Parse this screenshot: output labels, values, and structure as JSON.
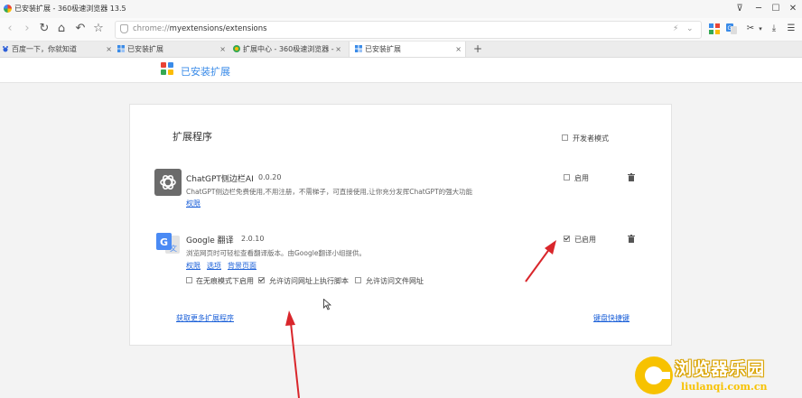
{
  "window": {
    "title": "已安装扩展 - 360极速浏览器 13.5",
    "controls": {
      "pin": "⊽",
      "minimize": "─",
      "maximize": "☐",
      "close": "✕"
    }
  },
  "address_bar": {
    "scheme": "chrome://",
    "host_path": "myextensions/extensions",
    "right_icons": [
      "⚡",
      "⌄",
      "☆"
    ]
  },
  "tabs": [
    {
      "label": "百度一下，你就知道",
      "active": false
    },
    {
      "label": "已安装扩展",
      "active": false
    },
    {
      "label": "扩展中心 - 360极速浏览器 -",
      "active": false
    },
    {
      "label": "已安装扩展",
      "active": true
    }
  ],
  "new_tab_label": "+",
  "header": {
    "title": "已安装扩展"
  },
  "section": {
    "title": "扩展程序",
    "developer_mode_label": "开发者模式",
    "developer_mode_checked": false
  },
  "extensions": [
    {
      "name": "ChatGPT侧边栏AI",
      "version": "0.0.20",
      "description": "ChatGPT侧边栏免费使用,不用注册，不需梯子，可直接使用,让你充分发挥ChatGPT的强大功能",
      "links": [
        "权限"
      ],
      "enable_label": "启用",
      "enabled": false
    },
    {
      "name": "Google 翻译",
      "version": "2.0.10",
      "description": "浏览网页时可轻松查看翻译版本。由Google翻译小组提供。",
      "links": [
        "权限",
        "选项",
        "背景页面"
      ],
      "enable_label": "已启用",
      "enabled": true,
      "options": [
        {
          "label": "在无痕模式下启用",
          "checked": false
        },
        {
          "label": "允许访问网址上执行脚本",
          "checked": true
        },
        {
          "label": "允许访问文件网址",
          "checked": false
        }
      ]
    }
  ],
  "footer": {
    "get_more": "获取更多扩展程序",
    "shortcuts": "键盘快捷键"
  },
  "watermark": {
    "title": "浏览器乐园",
    "url": "liulanqi.com.cn"
  },
  "colors": {
    "accent": "#3a8be8",
    "link": "#1a5fd8",
    "arrow": "#d9262b",
    "watermark": "#f7c200"
  }
}
